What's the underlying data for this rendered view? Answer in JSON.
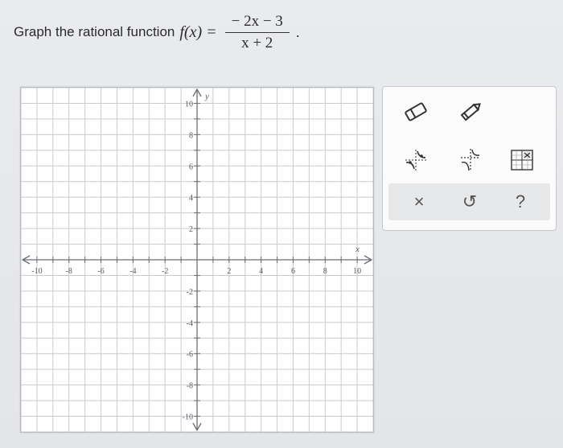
{
  "prompt": {
    "text": "Graph the rational function",
    "function_name": "f(x) =",
    "numerator": "− 2x − 3",
    "denominator": "x + 2",
    "trailing": "."
  },
  "graph": {
    "x_axis_label": "x",
    "y_axis_label": "y",
    "x_min": -11,
    "x_max": 11,
    "y_min": -11,
    "y_max": 11,
    "grid_step": 1,
    "x_tick_labels": [
      {
        "value": -10,
        "text": "-10"
      },
      {
        "value": -8,
        "text": "-8"
      },
      {
        "value": -6,
        "text": "-6"
      },
      {
        "value": -4,
        "text": "-4"
      },
      {
        "value": -2,
        "text": "-2"
      },
      {
        "value": 2,
        "text": "2"
      },
      {
        "value": 4,
        "text": "4"
      },
      {
        "value": 6,
        "text": "6"
      },
      {
        "value": 8,
        "text": "8"
      },
      {
        "value": 10,
        "text": "10"
      }
    ],
    "y_tick_labels": [
      {
        "value": 10,
        "text": "10"
      },
      {
        "value": 8,
        "text": "8"
      },
      {
        "value": 6,
        "text": "6"
      },
      {
        "value": 4,
        "text": "4"
      },
      {
        "value": 2,
        "text": "2"
      },
      {
        "value": -2,
        "text": "-2"
      },
      {
        "value": -4,
        "text": "-4"
      },
      {
        "value": -6,
        "text": "-6"
      },
      {
        "value": -8,
        "text": "-8"
      },
      {
        "value": -10,
        "text": "-10"
      }
    ],
    "colors": {
      "grid": "#c9cbcf",
      "axis": "#6b6e73",
      "label": "#555a60"
    }
  },
  "tools": {
    "eraser": "eraser-icon",
    "pencil": "pencil-icon",
    "rational_curve": "rational-curve-tool-icon",
    "asymptote": "asymptote-tool-icon",
    "grid_toggle": "graph-grid-icon",
    "clear_label": "×",
    "undo_label": "↺",
    "help_label": "?"
  }
}
